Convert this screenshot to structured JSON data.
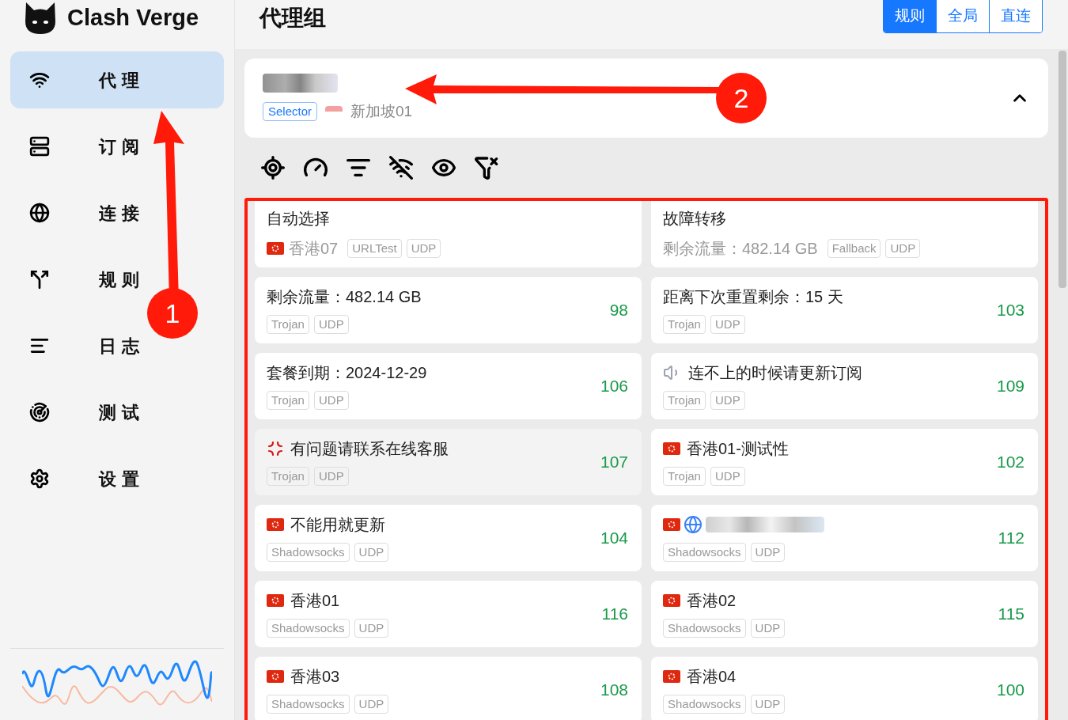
{
  "app": {
    "name": "Clash Verge"
  },
  "sidebar": {
    "items": [
      {
        "label": "代理",
        "kind": "wifi",
        "selected": true
      },
      {
        "label": "订阅",
        "kind": "server",
        "selected": false
      },
      {
        "label": "连接",
        "kind": "globe",
        "selected": false
      },
      {
        "label": "规则",
        "kind": "route",
        "selected": false
      },
      {
        "label": "日志",
        "kind": "lines",
        "selected": false
      },
      {
        "label": "测试",
        "kind": "radar",
        "selected": false
      },
      {
        "label": "设置",
        "kind": "gear",
        "selected": false
      }
    ]
  },
  "page": {
    "title": "代理组",
    "modes": [
      {
        "label": "规则",
        "selected": true
      },
      {
        "label": "全局",
        "selected": false
      },
      {
        "label": "直连",
        "selected": false
      }
    ]
  },
  "group": {
    "type": "Selector",
    "current": "新加坡01",
    "expanded": true
  },
  "annotations": [
    {
      "label": "1"
    },
    {
      "label": "2"
    }
  ],
  "proxies": [
    {
      "name": "自动选择",
      "subtitle": "香港07",
      "kind": "hk",
      "tags": [
        "URLTest",
        "UDP"
      ]
    },
    {
      "name": "故障转移",
      "subtitle": "剩余流量：482.14 GB",
      "kind": "plain",
      "tags": [
        "Fallback",
        "UDP"
      ]
    },
    {
      "name": "剩余流量：482.14 GB",
      "kind": "plain",
      "tags": [
        "Trojan",
        "UDP"
      ],
      "delay": "98"
    },
    {
      "name": "距离下次重置剩余：15 天",
      "kind": "plain",
      "tags": [
        "Trojan",
        "UDP"
      ],
      "delay": "103"
    },
    {
      "name": "套餐到期：2024-12-29",
      "kind": "plain",
      "tags": [
        "Trojan",
        "UDP"
      ],
      "delay": "106"
    },
    {
      "name": "连不上的时候请更新订阅",
      "kind": "speaker",
      "tags": [
        "Trojan",
        "UDP"
      ],
      "delay": "109"
    },
    {
      "name": "有问题请联系在线客服",
      "kind": "anger",
      "tags": [
        "Trojan",
        "UDP"
      ],
      "delay": "107"
    },
    {
      "name": "香港01-测试性",
      "kind": "hk",
      "tags": [
        "Trojan",
        "UDP"
      ],
      "delay": "102"
    },
    {
      "name": "不能用就更新",
      "kind": "hk",
      "tags": [
        "Shadowsocks",
        "UDP"
      ],
      "delay": "104"
    },
    {
      "kind": "hk-globe",
      "tags": [
        "Shadowsocks",
        "UDP"
      ],
      "delay": "112"
    },
    {
      "name": "香港01",
      "kind": "hk",
      "tags": [
        "Shadowsocks",
        "UDP"
      ],
      "delay": "116"
    },
    {
      "name": "香港02",
      "kind": "hk",
      "tags": [
        "Shadowsocks",
        "UDP"
      ],
      "delay": "115"
    },
    {
      "name": "香港03",
      "kind": "hk",
      "tags": [
        "Shadowsocks",
        "UDP"
      ],
      "delay": "108"
    },
    {
      "name": "香港04",
      "kind": "hk",
      "tags": [
        "Shadowsocks",
        "UDP"
      ],
      "delay": "100"
    }
  ]
}
